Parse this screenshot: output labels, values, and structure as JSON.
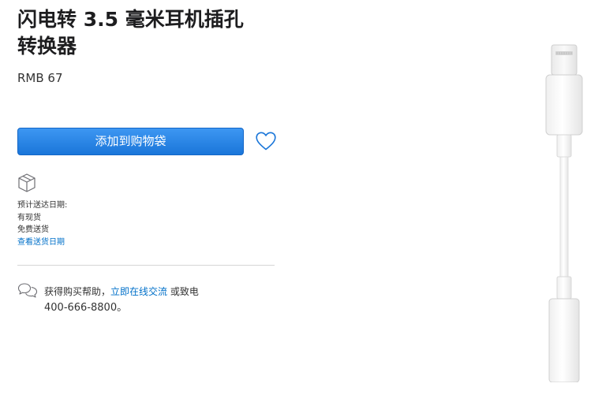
{
  "product": {
    "title_line1": "闪电转 3.5 毫米耳机插孔",
    "title_line2": "转换器",
    "price": "RMB 67"
  },
  "actions": {
    "add_to_bag_label": "添加到购物袋",
    "favorite_icon": "heart-icon"
  },
  "delivery": {
    "icon": "box-icon",
    "expected_label": "预计送达日期:",
    "stock_status": "有现货",
    "shipping": "免费送货",
    "view_link": "查看送货日期"
  },
  "help": {
    "icon": "chat-bubbles-icon",
    "prefix": "获得购买帮助，",
    "chat_link": "立即在线交流",
    "suffix": " 或致电",
    "phone": "400-666-8800。"
  },
  "colors": {
    "button_blue": "#1a76d9",
    "link_blue": "#0070c9",
    "divider": "#d6d6d6"
  }
}
